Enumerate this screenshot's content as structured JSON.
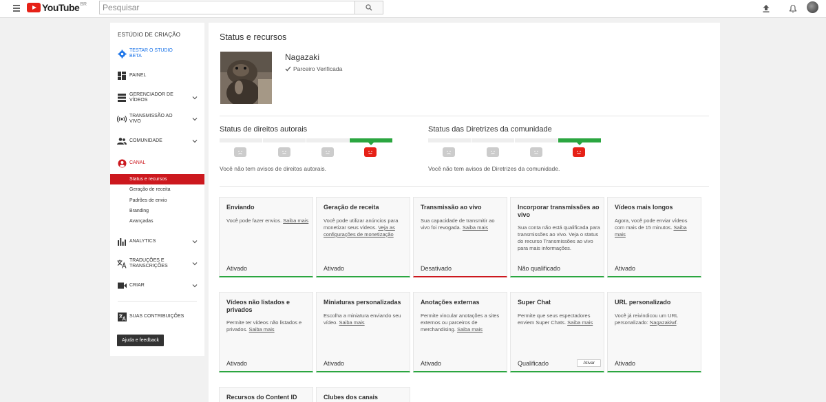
{
  "header": {
    "logo_text": "YouTube",
    "logo_region": "BR",
    "search_placeholder": "Pesquisar",
    "icons": [
      "menu-icon",
      "search-icon",
      "upload-icon",
      "bell-icon",
      "avatar"
    ]
  },
  "sidebar": {
    "title": "ESTÚDIO DE CRIAÇÃO",
    "beta_label": "TESTAR O STUDIO BETA",
    "items": [
      {
        "label": "PAINEL",
        "icon": "dashboard-icon"
      },
      {
        "label": "GERENCIADOR DE VÍDEOS",
        "icon": "video-manager-icon"
      },
      {
        "label": "TRANSMISSÃO AO VIVO",
        "icon": "live-icon"
      },
      {
        "label": "COMUNIDADE",
        "icon": "community-icon"
      },
      {
        "label": "CANAL",
        "icon": "channel-icon"
      },
      {
        "label": "ANALYTICS",
        "icon": "analytics-icon"
      },
      {
        "label": "TRADUÇÕES E TRANSCRIÇÕES",
        "icon": "translate-icon"
      },
      {
        "label": "CRIAR",
        "icon": "create-icon"
      },
      {
        "label": "SUAS CONTRIBUIÇÕES",
        "icon": "contributions-icon"
      }
    ],
    "channel_subitems": [
      "Status e recursos",
      "Geração de receita",
      "Padrões de envio",
      "Branding",
      "Avançadas"
    ],
    "help_button": "Ajuda e feedback",
    "accent_color": "#cc181e"
  },
  "main": {
    "title": "Status e recursos",
    "channel_name": "Nagazaki",
    "partner_status": "Parceiro Verificada",
    "copyright": {
      "title": "Status de direitos autorais",
      "note": "Você não tem avisos de direitos autorais."
    },
    "community": {
      "title": "Status das Diretrizes da comunidade",
      "note": "Você não tem avisos de Diretrizes da comunidade."
    },
    "cards": [
      {
        "title": "Enviando",
        "desc": "Você pode fazer envios.",
        "link": "Saiba mais",
        "status": "Ativado"
      },
      {
        "title": "Geração de receita",
        "desc": "Você pode utilizar anúncios para monetizar seus vídeos.",
        "link": "Veja as configurações de monetização",
        "status": "Ativado"
      },
      {
        "title": "Transmissão ao vivo",
        "desc": "Sua capacidade de transmitir ao vivo foi revogada.",
        "link": "Saiba mais",
        "status": "Desativado"
      },
      {
        "title": "Incorporar transmissões ao vivo",
        "desc": "Sua conta não está qualificada para transmissões ao vivo. Veja o status do recurso Transmissões ao vivo para mais informações.",
        "link": "",
        "status": "Não qualificado"
      },
      {
        "title": "Vídeos mais longos",
        "desc": "Agora, você pode enviar vídeos com mais de 15 minutos.",
        "link": "Saiba mais",
        "status": "Ativado"
      },
      {
        "title": "Vídeos não listados e privados",
        "desc": "Permite ter vídeos não listados e privados.",
        "link": "Saiba mais",
        "status": "Ativado"
      },
      {
        "title": "Miniaturas personalizadas",
        "desc": "Escolha a miniatura enviando seu vídeo.",
        "link": "Saiba mais",
        "status": "Ativado"
      },
      {
        "title": "Anotações externas",
        "desc": "Permite vincular anotações a sites externos ou parceiros de merchandising.",
        "link": "Saiba mais",
        "status": "Ativado"
      },
      {
        "title": "Super Chat",
        "desc": "Permite que seus espectadores enviem Super Chats.",
        "link": "Saiba mais",
        "status": "Qualificado",
        "action": "Ativar"
      },
      {
        "title": "URL personalizado",
        "desc": "Você já reivindicou um URL personalizado:",
        "link": "Nagazakiwf",
        "desc_suffix": ".",
        "status": "Ativado"
      },
      {
        "title": "Recursos do Content ID"
      },
      {
        "title": "Clubes dos canais"
      }
    ],
    "colors": {
      "enabled": "#2ba640",
      "disabled": "#cc181e"
    }
  }
}
